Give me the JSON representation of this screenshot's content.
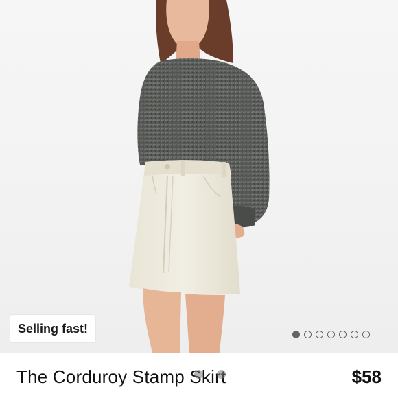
{
  "product": {
    "name": "The Corduroy Stamp Skirt",
    "price": "$58",
    "badge": "Selling fast!",
    "image_alt_icon": "product-photo"
  },
  "gallery": {
    "total_images": 7,
    "active_index": 0
  },
  "colors": {
    "background": "#f2f2f2",
    "sweater": "#5b5d5a",
    "skirt": "#ece8da",
    "dot": "#666666"
  }
}
